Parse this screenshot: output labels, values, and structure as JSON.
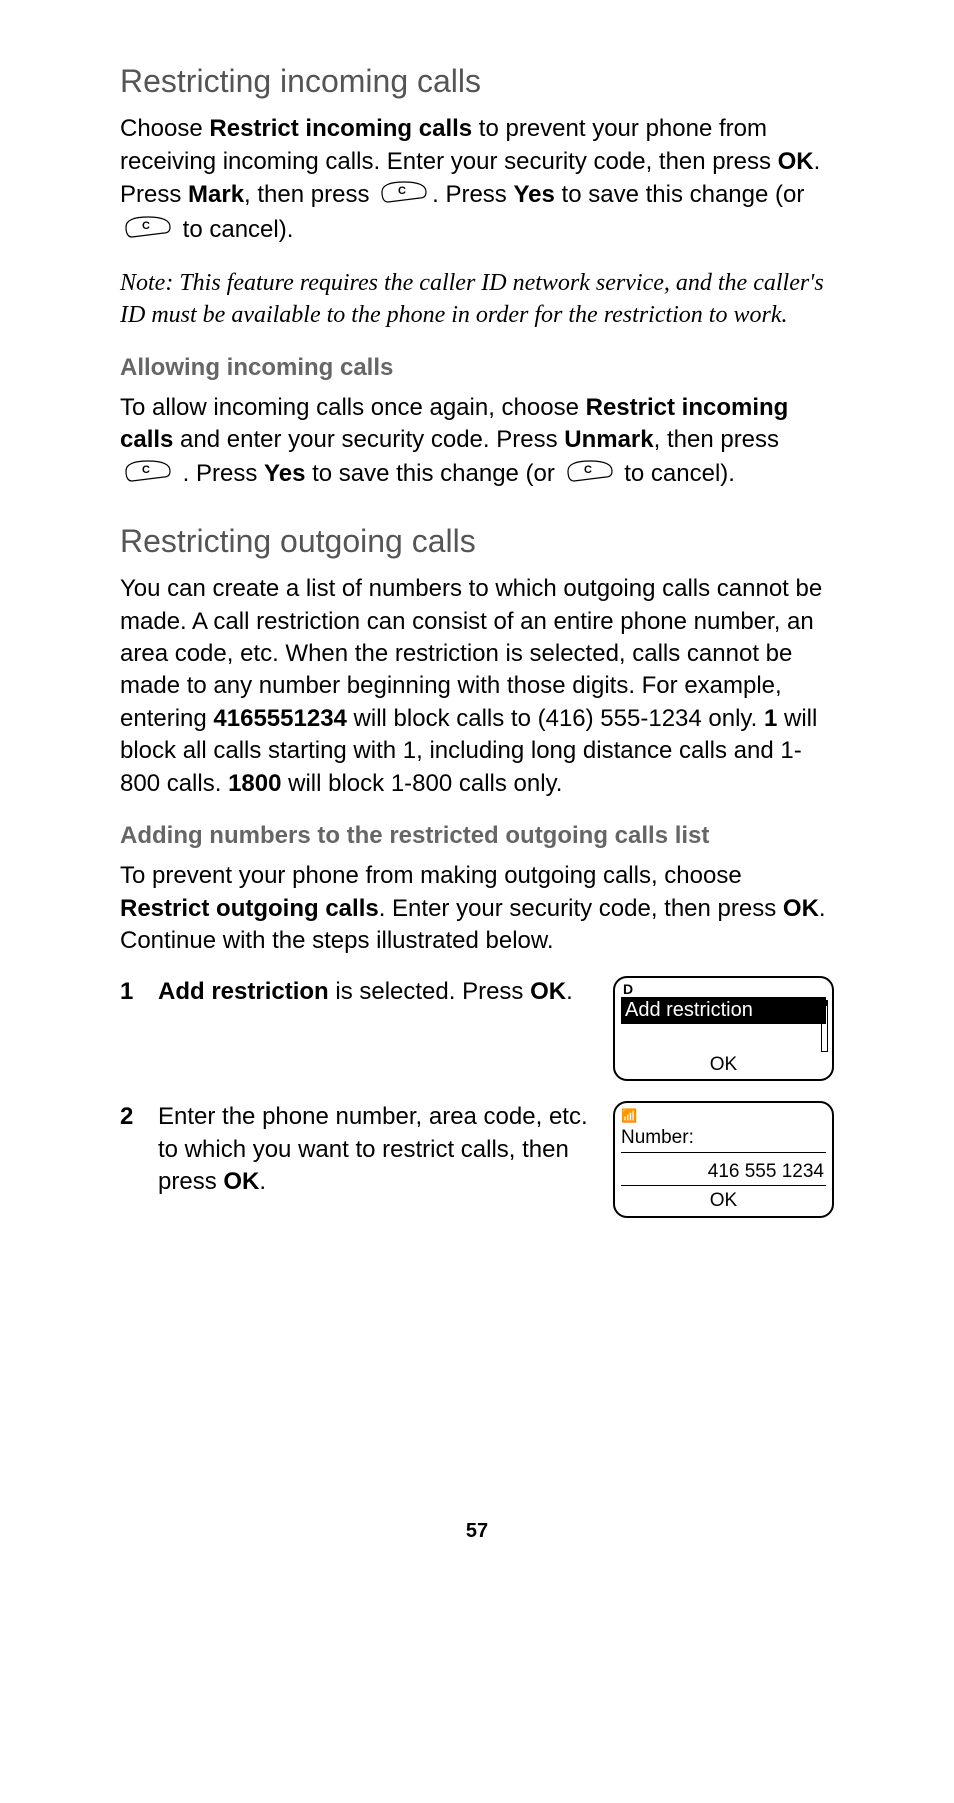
{
  "sections": {
    "h2_incoming": "Restricting incoming calls",
    "para_incoming_1a": "Choose ",
    "para_incoming_1b": "Restrict incoming calls",
    "para_incoming_1c": " to prevent your phone from receiving incoming calls. Enter your security code, then press ",
    "para_incoming_1d": "OK",
    "para_incoming_1e": ". Press ",
    "para_incoming_1f": "Mark",
    "para_incoming_1g": ", then press ",
    "para_incoming_1h": ". Press ",
    "para_incoming_1i": "Yes",
    "para_incoming_1j": " to save this change (or ",
    "para_incoming_1k": " to cancel).",
    "note": "Note:  This feature requires the caller ID network service, and the caller's ID must be available to the phone in order for the restriction to work.",
    "h3_allow": "Allowing incoming calls",
    "para_allow_a": "To allow incoming calls once again, choose ",
    "para_allow_b": "Restrict incoming calls",
    "para_allow_c": " and enter your security code. Press ",
    "para_allow_d": "Unmark",
    "para_allow_e": ", then press ",
    "para_allow_f": " . Press ",
    "para_allow_g": "Yes",
    "para_allow_h": " to save this change (or ",
    "para_allow_i": " to cancel).",
    "h2_outgoing": "Restricting outgoing calls",
    "para_out_a": "You can create a list of numbers to which outgoing calls cannot be made. A call restriction can consist of an entire phone number, an area code, etc. When the restriction is selected, calls cannot be made to any number beginning with those digits. For example, entering ",
    "para_out_b": "4165551234",
    "para_out_c": " will block calls to (416) 555-1234 only. ",
    "para_out_d": "1",
    "para_out_e": " will block all calls starting with 1, including long distance calls and 1-800 calls. ",
    "para_out_f": "1800",
    "para_out_g": " will block 1-800 calls only.",
    "h3_add": "Adding numbers to the restricted outgoing calls list",
    "para_add_a": "To prevent your phone from making outgoing calls, choose ",
    "para_add_b": "Restrict outgoing calls",
    "para_add_c": ". Enter your security code, then press ",
    "para_add_d": "OK",
    "para_add_e": ". Continue with the steps illustrated below.",
    "step1_num": "1",
    "step1_a": "Add restriction",
    "step1_b": " is selected. Press ",
    "step1_c": "OK",
    "step1_d": ".",
    "step2_num": "2",
    "step2_a": "Enter the phone number, area code, etc. to which you want to restrict calls, then press ",
    "step2_b": "OK",
    "step2_c": ".",
    "screen1_icon": "D",
    "screen1_selected": "Add restriction",
    "screen1_softkey": "OK",
    "screen2_label": "Number:",
    "screen2_value": "416 555 1234",
    "screen2_softkey": "OK",
    "page": "57"
  }
}
